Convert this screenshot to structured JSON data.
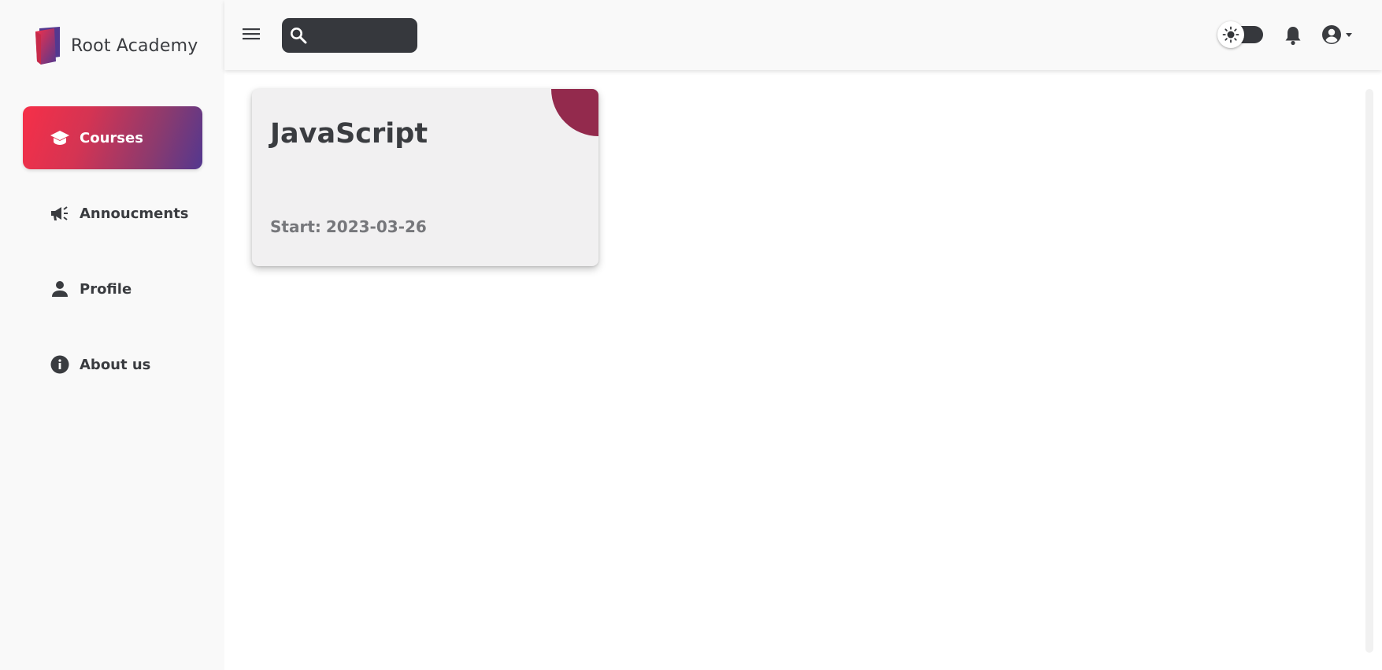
{
  "app": {
    "name": "Root Academy"
  },
  "sidebar": {
    "items": [
      {
        "label": "Courses",
        "icon": "graduation-cap-icon",
        "active": true
      },
      {
        "label": "Annoucments",
        "icon": "megaphone-icon",
        "active": false
      },
      {
        "label": "Profile",
        "icon": "person-icon",
        "active": false
      },
      {
        "label": "About us",
        "icon": "info-icon",
        "active": false
      }
    ]
  },
  "topbar": {
    "menu_icon": "hamburger-menu-icon",
    "search": {
      "placeholder": "",
      "value": "",
      "icon": "search-icon"
    },
    "theme_toggle": {
      "icon": "sun-icon",
      "mode": "light"
    },
    "notifications_icon": "bell-icon",
    "account_icon": "account-circle-icon"
  },
  "courses": [
    {
      "title": "JavaScript",
      "start_label": "Start:",
      "start_date": "2023-03-26",
      "accent_color": "#932a4d"
    }
  ],
  "colors": {
    "gradient_start": "#f62f48",
    "gradient_end": "#53388f",
    "dark": "#36383d",
    "accent": "#932a4d"
  }
}
